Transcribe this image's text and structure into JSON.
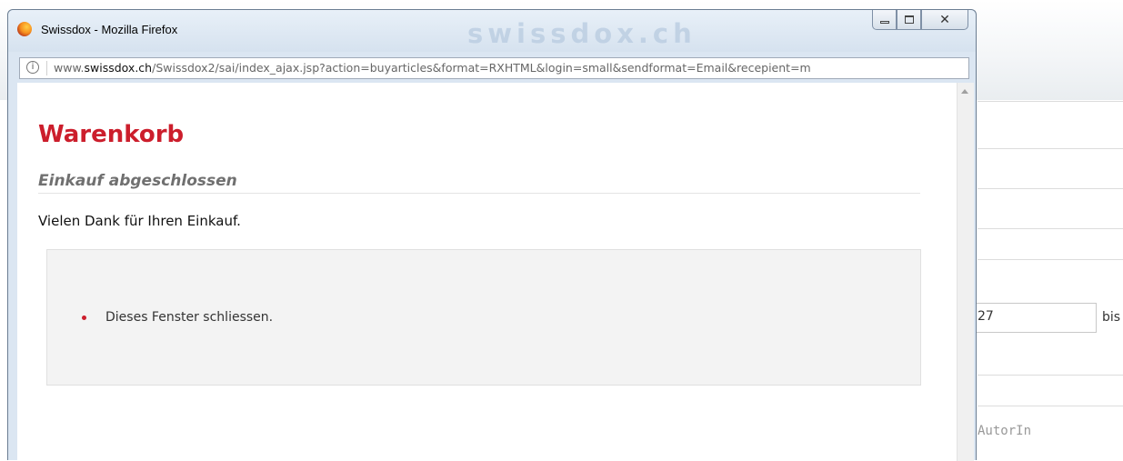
{
  "window": {
    "title": "Swissdox - Mozilla Firefox",
    "watermark": "swissdox.ch",
    "buttons": {
      "minimize": "",
      "maximize": "",
      "close": "✕"
    }
  },
  "urlbar": {
    "url_prefix": "www.",
    "url_domain": "swissdox.ch",
    "url_path": "/Swissdox2/sai/index_ajax.jsp?action=buyarticles&format=RXHTML&login=small&sendformat=Email&recepient=m"
  },
  "content": {
    "title": "Warenkorb",
    "section_title": "Einkauf abgeschlossen",
    "thanks_text": "Vielen Dank für Ihren Einkauf.",
    "actions": [
      {
        "label": "Dieses Fenster schliessen."
      }
    ]
  },
  "background_page": {
    "date_value": "27",
    "bis_label": "bis",
    "autorin_label": "AutorIn"
  },
  "colors": {
    "accent": "#cc1e2c",
    "section_title": "#707070",
    "box_bg": "#f3f3f3"
  },
  "icons": [
    "firefox-logo",
    "info-icon",
    "minimize-icon",
    "maximize-icon",
    "close-icon",
    "bullet-icon",
    "scroll-up-icon"
  ]
}
